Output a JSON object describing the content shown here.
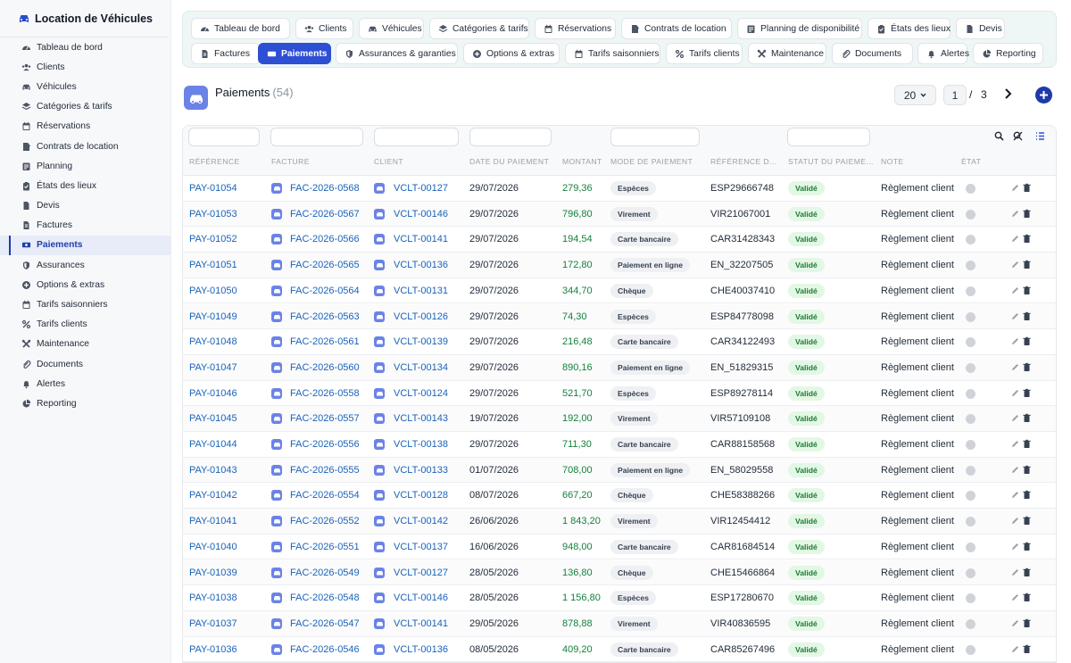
{
  "app": {
    "title": "Location de Véhicules",
    "brand_icon": "car-icon"
  },
  "sidebar": {
    "items": [
      {
        "label": "Tableau de bord",
        "icon": "dashboard-icon"
      },
      {
        "label": "Clients",
        "icon": "users-icon"
      },
      {
        "label": "Véhicules",
        "icon": "car-icon"
      },
      {
        "label": "Catégories & tarifs",
        "icon": "layers-icon"
      },
      {
        "label": "Réservations",
        "icon": "calendar-icon"
      },
      {
        "label": "Contrats de location",
        "icon": "contract-icon"
      },
      {
        "label": "Planning",
        "icon": "planning-icon"
      },
      {
        "label": "États des lieux",
        "icon": "clipboard-icon"
      },
      {
        "label": "Devis",
        "icon": "file-icon"
      },
      {
        "label": "Factures",
        "icon": "invoice-icon"
      },
      {
        "label": "Paiements",
        "icon": "money-icon",
        "active": true
      },
      {
        "label": "Assurances",
        "icon": "shield-icon"
      },
      {
        "label": "Options & extras",
        "icon": "plus-circle-icon"
      },
      {
        "label": "Tarifs saisonniers",
        "icon": "calendar-icon"
      },
      {
        "label": "Tarifs clients",
        "icon": "percent-icon"
      },
      {
        "label": "Maintenance",
        "icon": "wrench-icon"
      },
      {
        "label": "Documents",
        "icon": "paperclip-icon"
      },
      {
        "label": "Alertes",
        "icon": "bell-icon"
      },
      {
        "label": "Reporting",
        "icon": "pie-chart-icon"
      }
    ]
  },
  "tabs": [
    {
      "label": "Tableau de bord",
      "icon": "dashboard-icon"
    },
    {
      "label": "Clients",
      "icon": "users-icon"
    },
    {
      "label": "Véhicules",
      "icon": "car-icon"
    },
    {
      "label": "Catégories & tarifs",
      "icon": "layers-icon"
    },
    {
      "label": "Réservations",
      "icon": "calendar-icon"
    },
    {
      "label": "Contrats de location",
      "icon": "contract-icon"
    },
    {
      "label": "Planning de disponibilité",
      "icon": "planning-icon"
    },
    {
      "label": "États des lieux",
      "icon": "clipboard-icon"
    },
    {
      "label": "Devis",
      "icon": "file-icon"
    },
    {
      "label": "Factures",
      "icon": "invoice-icon"
    },
    {
      "label": "Paiements",
      "icon": "money-icon",
      "active": true
    },
    {
      "label": "Assurances & garanties",
      "icon": "shield-icon"
    },
    {
      "label": "Options & extras",
      "icon": "plus-circle-icon"
    },
    {
      "label": "Tarifs saisonniers",
      "icon": "calendar-icon"
    },
    {
      "label": "Tarifs clients",
      "icon": "percent-icon"
    },
    {
      "label": "Maintenance",
      "icon": "wrench-icon"
    },
    {
      "label": "Documents",
      "icon": "paperclip-icon"
    },
    {
      "label": "Alertes",
      "icon": "bell-icon"
    },
    {
      "label": "Reporting",
      "icon": "pie-chart-icon"
    }
  ],
  "page": {
    "title": "Paiements",
    "count": "(54)"
  },
  "pagination": {
    "page_size": "20",
    "current_page": "1",
    "separator": "/",
    "total_pages": "3"
  },
  "table": {
    "headers": [
      "RÉFÉRENCE",
      "FACTURE",
      "CLIENT",
      "DATE DU PAIEMENT",
      "MONTANT",
      "MODE DE PAIEMENT",
      "RÉFÉRENCE D...",
      "STATUT DU PAIEME...",
      "NOTE",
      "ÉTAT"
    ],
    "rows": [
      {
        "ref": "PAY-01054",
        "facture": "FAC-2026-0568",
        "client": "VCLT-00127",
        "date": "29/07/2026",
        "montant": "279,36",
        "mode": "Espèces",
        "refd": "ESP29666748",
        "statut": "Validé",
        "note": "Règlement client"
      },
      {
        "ref": "PAY-01053",
        "facture": "FAC-2026-0567",
        "client": "VCLT-00146",
        "date": "29/07/2026",
        "montant": "796,80",
        "mode": "Virement",
        "refd": "VIR21067001",
        "statut": "Validé",
        "note": "Règlement client"
      },
      {
        "ref": "PAY-01052",
        "facture": "FAC-2026-0566",
        "client": "VCLT-00141",
        "date": "29/07/2026",
        "montant": "194,54",
        "mode": "Carte bancaire",
        "refd": "CAR31428343",
        "statut": "Validé",
        "note": "Règlement client"
      },
      {
        "ref": "PAY-01051",
        "facture": "FAC-2026-0565",
        "client": "VCLT-00136",
        "date": "29/07/2026",
        "montant": "172,80",
        "mode": "Paiement en ligne",
        "refd": "EN_32207505",
        "statut": "Validé",
        "note": "Règlement client"
      },
      {
        "ref": "PAY-01050",
        "facture": "FAC-2026-0564",
        "client": "VCLT-00131",
        "date": "29/07/2026",
        "montant": "344,70",
        "mode": "Chèque",
        "refd": "CHE40037410",
        "statut": "Validé",
        "note": "Règlement client"
      },
      {
        "ref": "PAY-01049",
        "facture": "FAC-2026-0563",
        "client": "VCLT-00126",
        "date": "29/07/2026",
        "montant": "74,30",
        "mode": "Espèces",
        "refd": "ESP84778098",
        "statut": "Validé",
        "note": "Règlement client"
      },
      {
        "ref": "PAY-01048",
        "facture": "FAC-2026-0561",
        "client": "VCLT-00139",
        "date": "29/07/2026",
        "montant": "216,48",
        "mode": "Carte bancaire",
        "refd": "CAR34122493",
        "statut": "Validé",
        "note": "Règlement client"
      },
      {
        "ref": "PAY-01047",
        "facture": "FAC-2026-0560",
        "client": "VCLT-00134",
        "date": "29/07/2026",
        "montant": "890,16",
        "mode": "Paiement en ligne",
        "refd": "EN_51829315",
        "statut": "Validé",
        "note": "Règlement client"
      },
      {
        "ref": "PAY-01046",
        "facture": "FAC-2026-0558",
        "client": "VCLT-00124",
        "date": "29/07/2026",
        "montant": "521,70",
        "mode": "Espèces",
        "refd": "ESP89278114",
        "statut": "Validé",
        "note": "Règlement client"
      },
      {
        "ref": "PAY-01045",
        "facture": "FAC-2026-0557",
        "client": "VCLT-00143",
        "date": "19/07/2026",
        "montant": "192,00",
        "mode": "Virement",
        "refd": "VIR57109108",
        "statut": "Validé",
        "note": "Règlement client"
      },
      {
        "ref": "PAY-01044",
        "facture": "FAC-2026-0556",
        "client": "VCLT-00138",
        "date": "29/07/2026",
        "montant": "711,30",
        "mode": "Carte bancaire",
        "refd": "CAR88158568",
        "statut": "Validé",
        "note": "Règlement client"
      },
      {
        "ref": "PAY-01043",
        "facture": "FAC-2026-0555",
        "client": "VCLT-00133",
        "date": "01/07/2026",
        "montant": "708,00",
        "mode": "Paiement en ligne",
        "refd": "EN_58029558",
        "statut": "Validé",
        "note": "Règlement client"
      },
      {
        "ref": "PAY-01042",
        "facture": "FAC-2026-0554",
        "client": "VCLT-00128",
        "date": "08/07/2026",
        "montant": "667,20",
        "mode": "Chèque",
        "refd": "CHE58388266",
        "statut": "Validé",
        "note": "Règlement client"
      },
      {
        "ref": "PAY-01041",
        "facture": "FAC-2026-0552",
        "client": "VCLT-00142",
        "date": "26/06/2026",
        "montant": "1 843,20",
        "mode": "Virement",
        "refd": "VIR12454412",
        "statut": "Validé",
        "note": "Règlement client"
      },
      {
        "ref": "PAY-01040",
        "facture": "FAC-2026-0551",
        "client": "VCLT-00137",
        "date": "16/06/2026",
        "montant": "948,00",
        "mode": "Carte bancaire",
        "refd": "CAR81684514",
        "statut": "Validé",
        "note": "Règlement client"
      },
      {
        "ref": "PAY-01039",
        "facture": "FAC-2026-0549",
        "client": "VCLT-00127",
        "date": "28/05/2026",
        "montant": "136,80",
        "mode": "Chèque",
        "refd": "CHE15466864",
        "statut": "Validé",
        "note": "Règlement client"
      },
      {
        "ref": "PAY-01038",
        "facture": "FAC-2026-0548",
        "client": "VCLT-00146",
        "date": "28/05/2026",
        "montant": "1 156,80",
        "mode": "Espèces",
        "refd": "ESP17280670",
        "statut": "Validé",
        "note": "Règlement client"
      },
      {
        "ref": "PAY-01037",
        "facture": "FAC-2026-0547",
        "client": "VCLT-00141",
        "date": "29/05/2026",
        "montant": "878,88",
        "mode": "Virement",
        "refd": "VIR40836595",
        "statut": "Validé",
        "note": "Règlement client"
      },
      {
        "ref": "PAY-01036",
        "facture": "FAC-2026-0546",
        "client": "VCLT-00136",
        "date": "08/05/2026",
        "montant": "409,20",
        "mode": "Carte bancaire",
        "refd": "CAR85267496",
        "statut": "Validé",
        "note": "Règlement client"
      }
    ]
  },
  "colors": {
    "accent": "#2d4fd3",
    "link": "#1b63b8",
    "amount": "#15803d",
    "status_bg": "#e3f7e5"
  }
}
